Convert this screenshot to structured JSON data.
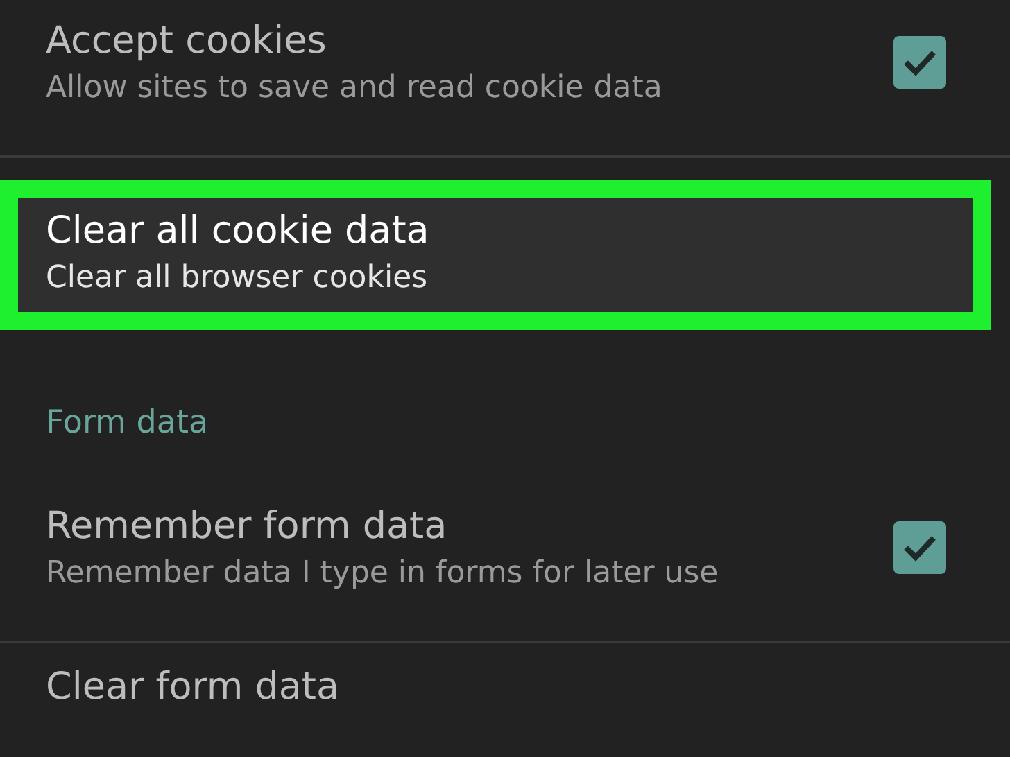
{
  "settings": [
    {
      "kind": "toggle",
      "title": "Accept cookies",
      "subtitle": "Allow sites to save and read cookie data",
      "checked": true,
      "highlighted": false
    },
    {
      "kind": "action",
      "title": "Clear all cookie data",
      "subtitle": "Clear all browser cookies",
      "highlighted": true
    },
    {
      "kind": "header",
      "title": "Form data"
    },
    {
      "kind": "toggle",
      "title": "Remember form data",
      "subtitle": "Remember data I type in forms for later use",
      "checked": true,
      "highlighted": false
    },
    {
      "kind": "action",
      "title": "Clear form data",
      "highlighted": false
    }
  ]
}
